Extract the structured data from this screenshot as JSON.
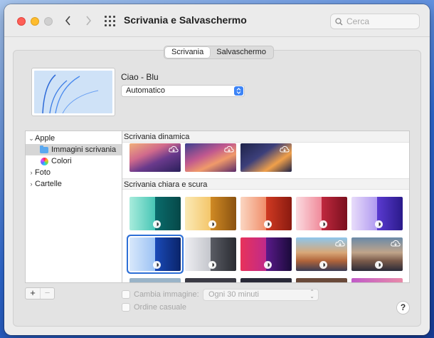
{
  "window": {
    "title": "Scrivania e Salvaschermo"
  },
  "search": {
    "placeholder": "Cerca"
  },
  "tabs": [
    {
      "label": "Scrivania",
      "active": true
    },
    {
      "label": "Salvaschermo",
      "active": false
    }
  ],
  "current_wallpaper": {
    "name": "Ciao - Blu",
    "mode": "Automatico"
  },
  "sidebar": {
    "items": [
      {
        "label": "Apple",
        "expanded": true,
        "level": 0
      },
      {
        "label": "Immagini scrivania",
        "selected": true,
        "level": 1,
        "icon": "folder-icon"
      },
      {
        "label": "Colori",
        "level": 1,
        "icon": "colors-icon"
      },
      {
        "label": "Foto",
        "expanded": false,
        "level": 0
      },
      {
        "label": "Cartelle",
        "expanded": false,
        "level": 0
      }
    ]
  },
  "sections": [
    {
      "title": "Scrivania dinamica"
    },
    {
      "title": "Scrivania chiara e scura"
    }
  ],
  "options": {
    "change_picture_label": "Cambia immagine:",
    "interval": "Ogni 30 minuti",
    "random_label": "Ordine casuale"
  },
  "buttons": {
    "add": "+",
    "remove": "−",
    "help": "?"
  },
  "colors": {
    "accent": "#3d84f6",
    "selection": "#2d6fd6"
  }
}
